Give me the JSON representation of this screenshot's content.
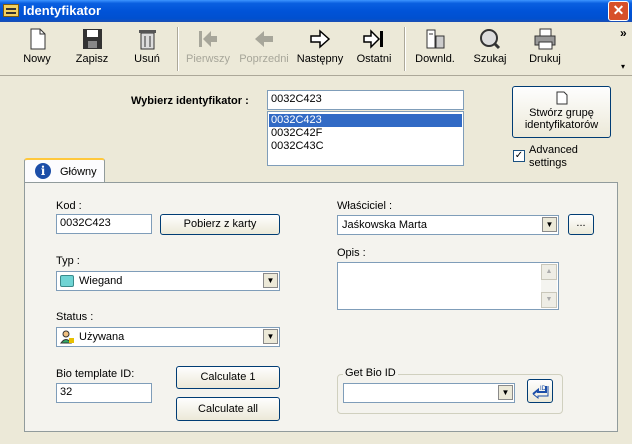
{
  "window": {
    "title": "Identyfikator",
    "close": "✕"
  },
  "toolbar": {
    "new": "Nowy",
    "save": "Zapisz",
    "delete": "Usuń",
    "first": "Pierwszy",
    "prev": "Poprzedni",
    "next": "Następny",
    "last": "Ostatni",
    "download": "Downld.",
    "search": "Szukaj",
    "print": "Drukuj",
    "more": "»",
    "more_down": "▾"
  },
  "selector": {
    "label": "Wybierz identyfikator :",
    "value": "0032C423",
    "options": [
      "0032C423",
      "0032C42F",
      "0032C43C"
    ],
    "selected_index": 0
  },
  "group_button": {
    "label_line1": "Stwórz grupę",
    "label_line2": "identyfikatorów"
  },
  "advanced": {
    "label_line1": "Advanced",
    "label_line2": "settings",
    "checked": true,
    "mark": "✓"
  },
  "tab": {
    "label": "Główny",
    "icon_glyph": "i"
  },
  "form": {
    "kod_label": "Kod :",
    "kod_value": "0032C423",
    "read_card": "Pobierz z karty",
    "typ_label": "Typ :",
    "typ_value": "Wiegand",
    "status_label": "Status :",
    "status_value": "Używana",
    "bio_label": "Bio template ID:",
    "bio_value": "32",
    "calc1": "Calculate 1",
    "calc_all": "Calculate all",
    "owner_label": "Właściciel :",
    "owner_value": "Jaśkowska Marta",
    "owner_browse": "...",
    "opis_label": "Opis :",
    "opis_value": "",
    "bio_group_label": "Get Bio ID",
    "bio_combo_value": "",
    "bio_action_glyph": "ID"
  }
}
